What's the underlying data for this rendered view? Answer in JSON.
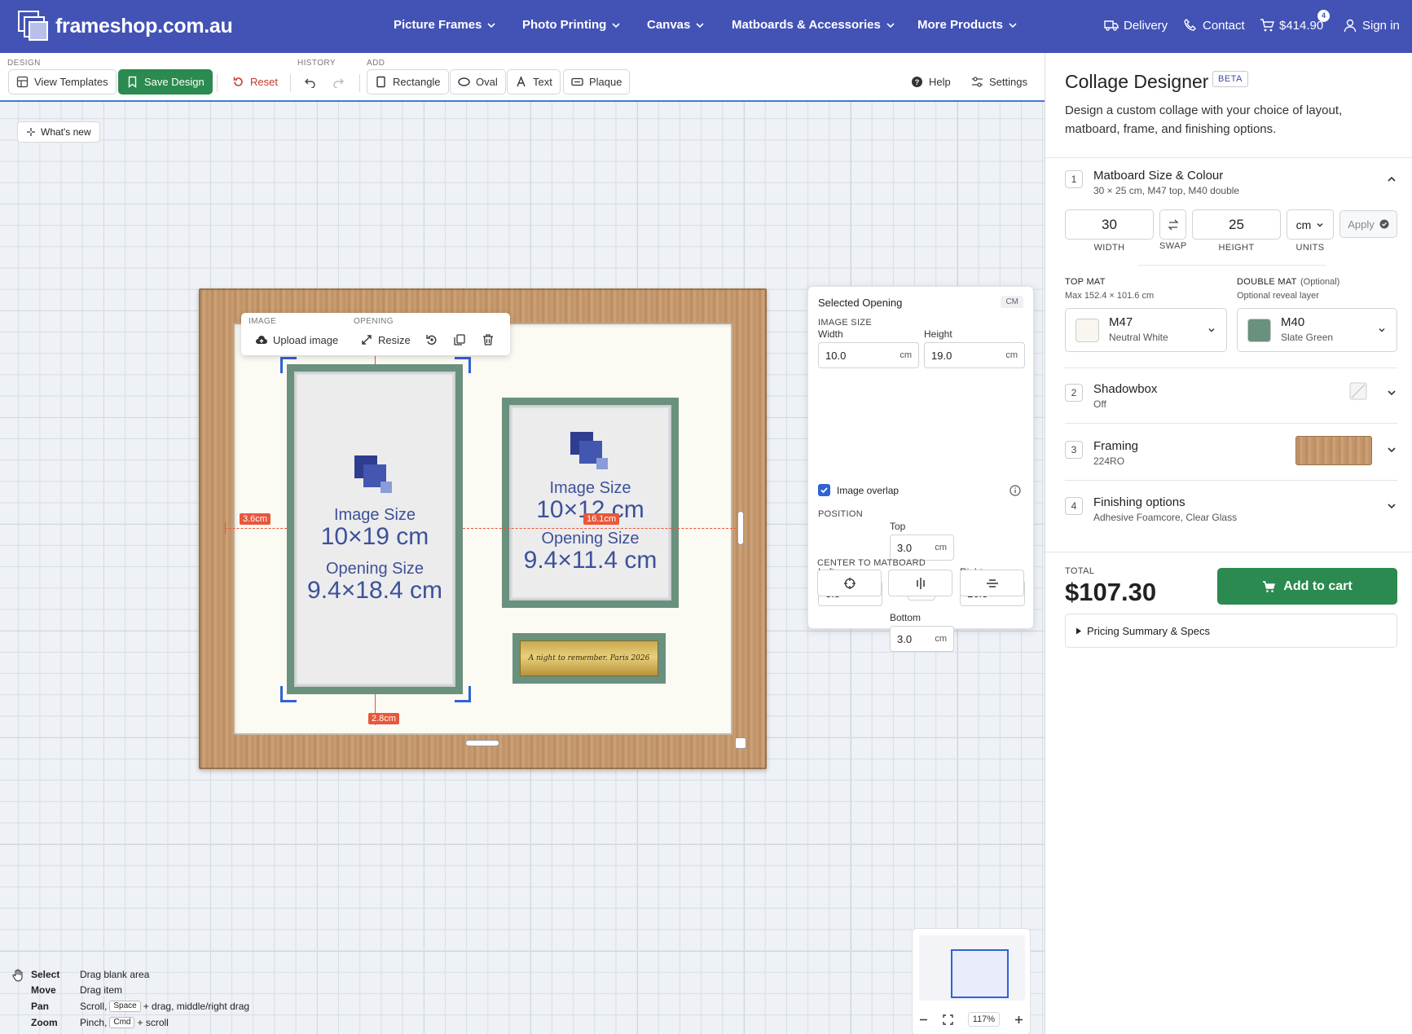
{
  "brand": {
    "name": "frameshop.com.au"
  },
  "nav": [
    {
      "label": "Picture Frames"
    },
    {
      "label": "Photo Printing"
    },
    {
      "label": "Canvas"
    },
    {
      "label": "Matboards & Accessories"
    },
    {
      "label": "More Products"
    }
  ],
  "utility": {
    "delivery": "Delivery",
    "contact": "Contact",
    "cart_total": "$414.90",
    "cart_count": "4",
    "signin": "Sign in"
  },
  "toolbar": {
    "design_label": "DESIGN",
    "history_label": "HISTORY",
    "add_label": "ADD",
    "view_templates": "View Templates",
    "save_design": "Save Design",
    "reset": "Reset",
    "rectangle": "Rectangle",
    "oval": "Oval",
    "text": "Text",
    "plaque": "Plaque",
    "help": "Help",
    "settings": "Settings"
  },
  "canvas": {
    "whats_new": "What's new",
    "opening_tools": {
      "image_label": "IMAGE",
      "opening_label": "OPENING",
      "upload": "Upload image",
      "resize": "Resize"
    },
    "openings": [
      {
        "image_caption": "Image Size",
        "image_size": "10×19 cm",
        "opening_caption": "Opening Size",
        "opening_size": "9.4×18.4 cm"
      },
      {
        "image_caption": "Image Size",
        "image_size": "10×12 cm",
        "opening_caption": "Opening Size",
        "opening_size": "9.4×11.4 cm"
      }
    ],
    "plaque_text": "A night to remember. Paris 2026",
    "measures": {
      "left": "3.6cm",
      "right": "16.1cm",
      "bottom": "2.8cm"
    },
    "zoom": "117%"
  },
  "selected_opening": {
    "title": "Selected Opening",
    "unit_badge": "CM",
    "image_size_label": "IMAGE SIZE",
    "width_label": "Width",
    "height_label": "Height",
    "width": "10.0",
    "height": "19.0",
    "unit": "cm",
    "image_overlap": "Image overlap",
    "image_overlap_checked": true,
    "position_label": "POSITION",
    "top_label": "Top",
    "left_label": "Left",
    "right_label": "Right",
    "bottom_label": "Bottom",
    "top": "3.0",
    "left": "3.8",
    "right": "16.3",
    "bottom": "3.0",
    "center_label": "CENTER TO MATBOARD"
  },
  "legend": [
    {
      "action": "Select",
      "desc": "Drag blank area"
    },
    {
      "action": "Move",
      "desc": "Drag item"
    },
    {
      "action": "Pan",
      "pre": "Scroll,",
      "key": "Space",
      "post": "+ drag, middle/right drag"
    },
    {
      "action": "Zoom",
      "pre": "Pinch,",
      "key": "Cmd",
      "post": "+ scroll"
    }
  ],
  "panel": {
    "title": "Collage Designer",
    "beta": "BETA",
    "description": "Design a custom collage with your choice of layout, matboard, frame, and finishing options.",
    "steps": [
      {
        "num": "1",
        "title": "Matboard Size & Colour",
        "sub": "30 × 25 cm, M47 top, M40 double"
      },
      {
        "num": "2",
        "title": "Shadowbox",
        "sub": "Off"
      },
      {
        "num": "3",
        "title": "Framing",
        "sub": "224RO"
      },
      {
        "num": "4",
        "title": "Finishing options",
        "sub": "Adhesive Foamcore, Clear Glass"
      }
    ],
    "size": {
      "width": "30",
      "height": "25",
      "units": "cm",
      "width_label": "WIDTH",
      "swap_label": "SWAP",
      "height_label": "HEIGHT",
      "units_label": "UNITS",
      "apply": "Apply"
    },
    "top_mat": {
      "label": "TOP MAT",
      "sub": "Max 152.4 × 101.6 cm",
      "code": "M47",
      "name": "Neutral White",
      "color": "#f8f6ee"
    },
    "double_mat": {
      "label": "DOUBLE MAT",
      "optional": "(Optional)",
      "sub": "Optional reveal layer",
      "code": "M40",
      "name": "Slate Green",
      "color": "#6a907e"
    },
    "total_label": "TOTAL",
    "total": "$107.30",
    "add_to_cart": "Add to cart",
    "pricing_summary": "Pricing Summary & Specs"
  }
}
